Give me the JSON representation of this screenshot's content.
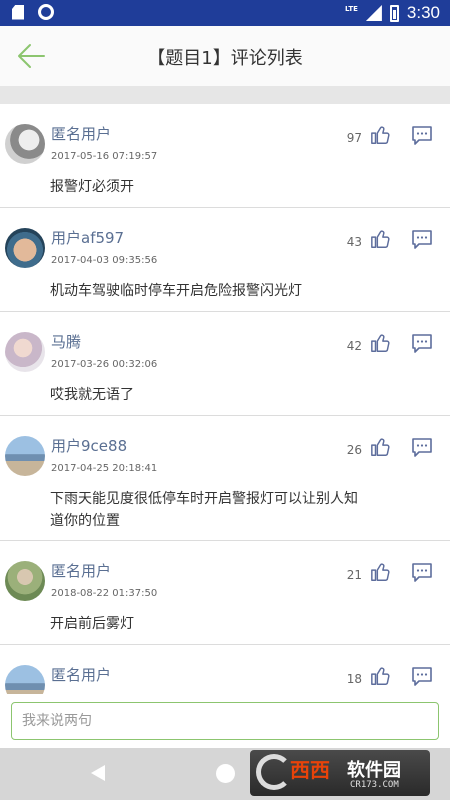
{
  "status_bar": {
    "time": "3:30",
    "network": "LTE"
  },
  "header": {
    "title": "【题目1】评论列表"
  },
  "comments": [
    {
      "username": "匿名用户",
      "time": "2017-05-16 07:19:57",
      "content": "报警灯必须开",
      "likes": "97",
      "avatar_color": "#bdbdbd"
    },
    {
      "username": "用户af597",
      "time": "2017-04-03 09:35:56",
      "content": "机动车驾驶临时停车开启危险报警闪光灯",
      "likes": "43",
      "avatar_color": "#3f6c8c"
    },
    {
      "username": "马腾",
      "time": "2017-03-26 00:32:06",
      "content": "哎我就无语了",
      "likes": "42",
      "avatar_color": "#c9b7c9"
    },
    {
      "username": "用户9ce88",
      "time": "2017-04-25 20:18:41",
      "content": "下雨天能见度很低停车时开启警报灯可以让别人知道你的位置",
      "likes": "26",
      "avatar_color": "#8fb3d6"
    },
    {
      "username": "匿名用户",
      "time": "2018-08-22 01:37:50",
      "content": "开启前后雾灯",
      "likes": "21",
      "avatar_color": "#9bb07a"
    },
    {
      "username": "匿名用户",
      "time": "",
      "content": "",
      "likes": "18",
      "avatar_color": "#8fb3d6"
    }
  ],
  "input": {
    "placeholder": "我来说两句"
  },
  "watermark": {
    "name": "西西",
    "name2": "软件园",
    "url": "CR173.COM"
  },
  "colors": {
    "status_bar": "#1f3d99",
    "accent": "#8cc56f",
    "username": "#5a6f92",
    "icon": "#5d6d9c"
  }
}
